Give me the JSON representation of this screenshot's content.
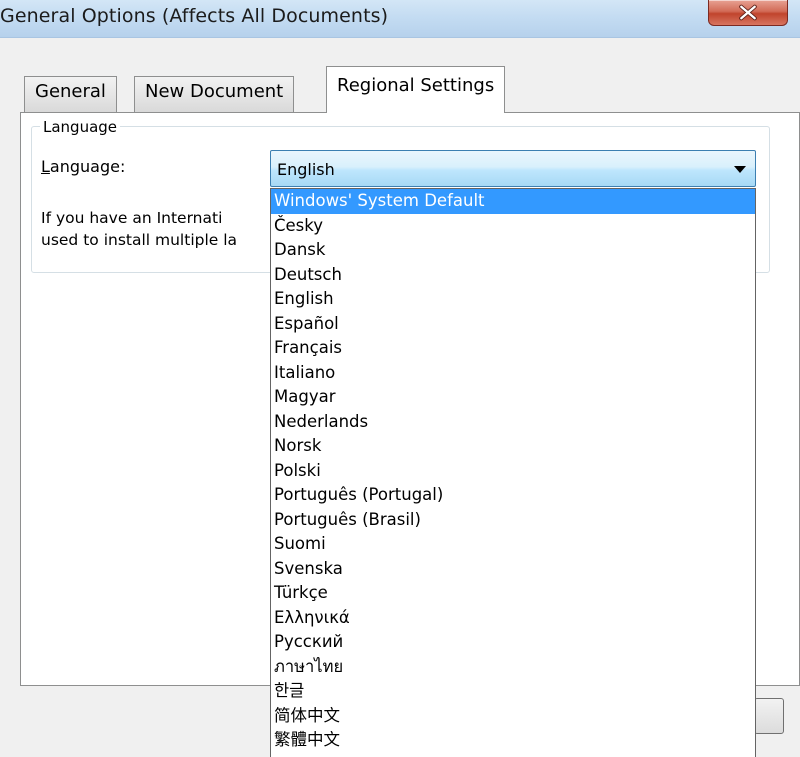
{
  "window": {
    "title": "General Options (Affects All Documents)"
  },
  "tabs": [
    {
      "label": "General"
    },
    {
      "label": "New Document"
    },
    {
      "label": "Regional Settings"
    }
  ],
  "language_group": {
    "legend": "Language",
    "field_label_accel": "L",
    "field_label_rest": "anguage:",
    "selected_value": "English",
    "info_line1": "If you have an Internati",
    "info_line2": "used to install multiple la"
  },
  "dropdown": {
    "items": [
      "Windows' System Default",
      "Česky",
      "Dansk",
      "Deutsch",
      "English",
      "Español",
      "Français",
      "Italiano",
      "Magyar",
      "Nederlands",
      "Norsk",
      "Polski",
      "Português (Portugal)",
      "Português (Brasil)",
      "Suomi",
      "Svenska",
      "Türkçe",
      "Ελληνικά",
      "Русский",
      "ภาษาไทย",
      "한글",
      "简体中文",
      "繁體中文"
    ],
    "highlighted_index": 0
  },
  "icons": {
    "close": "close-icon",
    "dropdown_arrow": "chevron-down-icon"
  },
  "colors": {
    "highlight": "#3399ff",
    "close_button": "#c0442d"
  }
}
